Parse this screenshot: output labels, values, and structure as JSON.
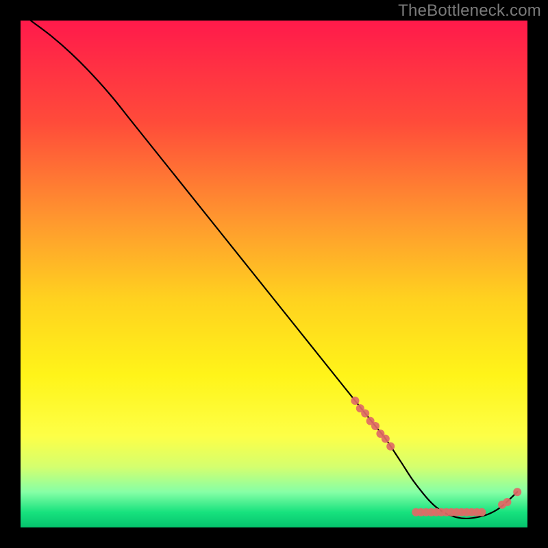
{
  "watermark": "TheBottleneck.com",
  "chart_data": {
    "type": "line",
    "xlim": [
      0,
      100
    ],
    "ylim": [
      0,
      100
    ],
    "title": "",
    "xlabel": "",
    "ylabel": "",
    "grid": false,
    "legend": false,
    "gradient_stops": [
      {
        "offset": 0.0,
        "color": "#ff1a4b"
      },
      {
        "offset": 0.2,
        "color": "#ff4b3a"
      },
      {
        "offset": 0.4,
        "color": "#ff9a2e"
      },
      {
        "offset": 0.55,
        "color": "#ffd21f"
      },
      {
        "offset": 0.7,
        "color": "#fff419"
      },
      {
        "offset": 0.82,
        "color": "#fdff47"
      },
      {
        "offset": 0.88,
        "color": "#d5ff6e"
      },
      {
        "offset": 0.93,
        "color": "#86ffa6"
      },
      {
        "offset": 0.97,
        "color": "#17e27e"
      },
      {
        "offset": 1.0,
        "color": "#05c36d"
      }
    ],
    "series": [
      {
        "name": "bottleneck-curve",
        "color": "#000000",
        "x": [
          2,
          6,
          10,
          14,
          18,
          22,
          30,
          40,
          50,
          60,
          66,
          70,
          72,
          75,
          78,
          82,
          86,
          90,
          94,
          98
        ],
        "y": [
          100,
          97,
          93.5,
          89.5,
          85,
          80,
          70,
          57.5,
          45,
          32.5,
          25,
          20,
          17.5,
          13,
          8.5,
          4,
          2,
          2,
          3.5,
          7
        ]
      }
    ],
    "markers": [
      {
        "name": "dense-cluster",
        "color": "#e06a66",
        "radius_px": 6,
        "points": [
          {
            "x": 66,
            "y": 25
          },
          {
            "x": 67,
            "y": 23.5
          },
          {
            "x": 68,
            "y": 22.5
          },
          {
            "x": 69,
            "y": 21
          },
          {
            "x": 70,
            "y": 20
          },
          {
            "x": 71,
            "y": 18.5
          },
          {
            "x": 72,
            "y": 17.5
          },
          {
            "x": 73,
            "y": 16
          },
          {
            "x": 78,
            "y": 3
          },
          {
            "x": 79,
            "y": 3
          },
          {
            "x": 80,
            "y": 3
          },
          {
            "x": 81,
            "y": 3
          },
          {
            "x": 82,
            "y": 3
          },
          {
            "x": 83,
            "y": 3
          },
          {
            "x": 84,
            "y": 3
          },
          {
            "x": 85,
            "y": 3
          },
          {
            "x": 86,
            "y": 3
          },
          {
            "x": 87,
            "y": 3
          },
          {
            "x": 88,
            "y": 3
          },
          {
            "x": 89,
            "y": 3
          },
          {
            "x": 90,
            "y": 3
          },
          {
            "x": 91,
            "y": 3
          },
          {
            "x": 95,
            "y": 4.5
          },
          {
            "x": 96,
            "y": 5
          },
          {
            "x": 98,
            "y": 7
          }
        ]
      }
    ]
  }
}
